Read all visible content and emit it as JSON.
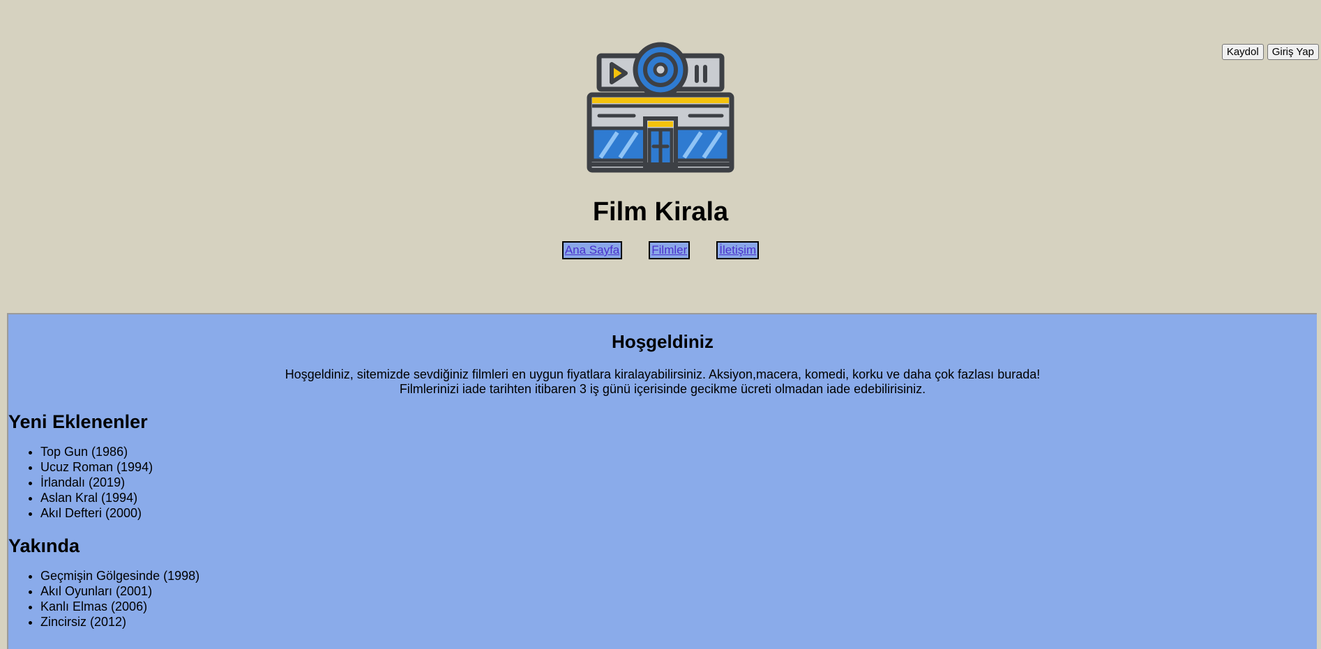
{
  "auth": {
    "register_label": "Kaydol",
    "login_label": "Giriş Yap"
  },
  "header": {
    "title": "Film Kirala"
  },
  "nav": {
    "items": [
      "Ana Sayfa",
      "Filmler",
      "İletişim"
    ]
  },
  "welcome": {
    "title": "Hoşgeldiniz",
    "line1": "Hoşgeldiniz, sitemizde sevdiğiniz filmleri en uygun fiyatlara kiralayabilirsiniz. Aksiyon,macera, komedi, korku ve daha çok fazlası burada!",
    "line2": "Filmlerinizi iade tarihten itibaren 3 iş günü içerisinde gecikme ücreti olmadan iade edebilirisiniz."
  },
  "new_releases": {
    "title": "Yeni Eklenenler",
    "items": [
      "Top Gun (1986)",
      "Ucuz Roman (1994)",
      "İrlandalı (2019)",
      "Aslan Kral (1994)",
      "Akıl Defteri (2000)"
    ]
  },
  "coming_soon": {
    "title": "Yakında",
    "items": [
      "Geçmişin Gölgesinde (1998)",
      "Akıl Oyunları (2001)",
      "Kanlı Elmas (2006)",
      "Zincirsiz (2012)"
    ]
  },
  "colors": {
    "page_bg": "#d6d2c0",
    "content_bg": "#8aabea",
    "link": "#4a32cc"
  },
  "logo_icon": "cinema-building-icon"
}
